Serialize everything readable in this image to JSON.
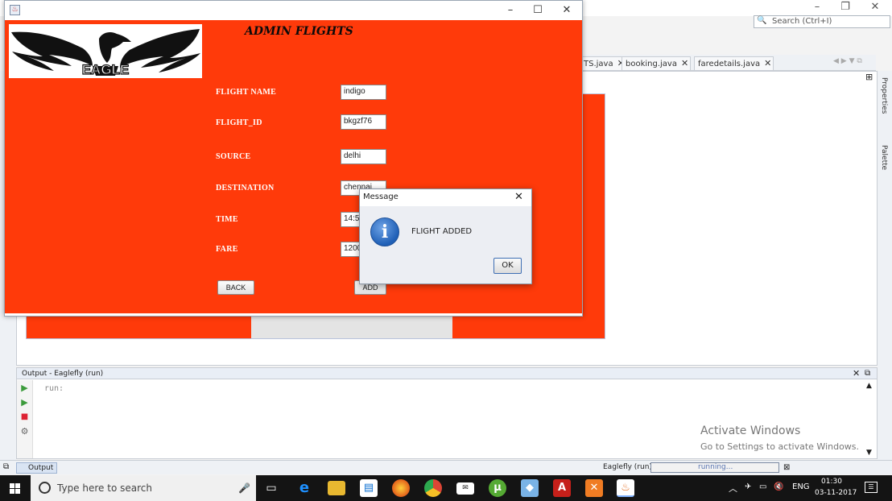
{
  "ide": {
    "search_placeholder": "Search (Ctrl+I)",
    "editor_tabs": [
      {
        "label": "TS.java"
      },
      {
        "label": "booking.java"
      },
      {
        "label": "faredetails.java"
      }
    ],
    "side_tabs": [
      "Properties",
      "Palette"
    ],
    "output": {
      "title": "Output - Eaglefly (run)",
      "text": "run:",
      "tab_label": "Output"
    },
    "status": {
      "app": "Eaglefly (run)",
      "progress": "running..."
    },
    "watermark": {
      "line1": "Activate Windows",
      "line2": "Go to Settings to activate Windows."
    }
  },
  "app": {
    "logo_text": "EAGLE",
    "heading": "ADMIN FLIGHTS",
    "fields": [
      {
        "label": "FLIGHT NAME",
        "value": "indigo"
      },
      {
        "label": "FLIGHT_ID",
        "value": "bkgzf76"
      },
      {
        "label": "SOURCE",
        "value": "delhi"
      },
      {
        "label": "DESTINATION",
        "value": "chennai"
      },
      {
        "label": "TIME",
        "value": "14:5"
      },
      {
        "label": "FARE",
        "value": "1200"
      }
    ],
    "back_label": "BACK",
    "add_label": "ADD"
  },
  "dialog": {
    "title": "Message",
    "message": "FLIGHT ADDED",
    "ok_label": "OK",
    "icon": "info-icon"
  },
  "taskbar": {
    "search_placeholder": "Type here to search",
    "language": "ENG",
    "time": "01:30",
    "date": "03-11-2017"
  },
  "colors": {
    "form_background": "#ff3a0a",
    "taskbar": "#141414",
    "info_icon": "#1f5fb6"
  }
}
